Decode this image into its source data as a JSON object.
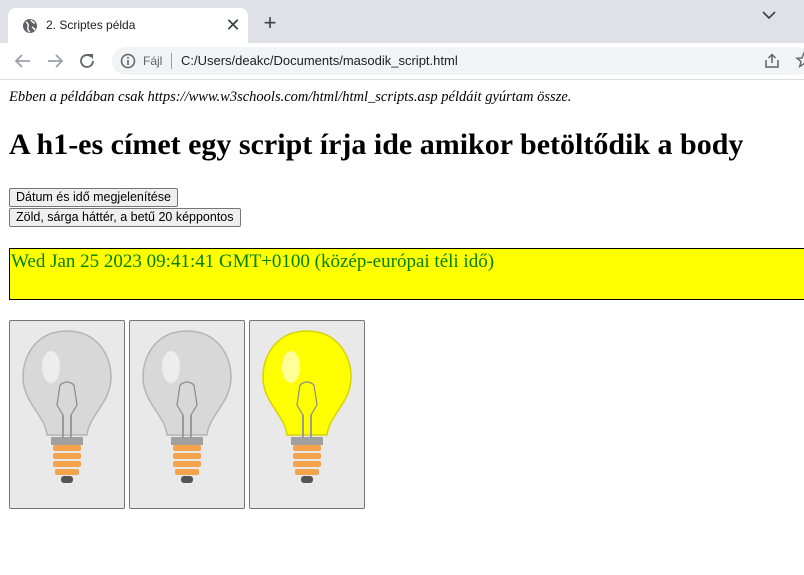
{
  "tab": {
    "title": "2. Scriptes példa",
    "favicon": "globe-icon",
    "close": "✕"
  },
  "newtab": "+",
  "toolbar": {
    "scheme_label": "Fájl",
    "url": "C:/Users/deakc/Documents/masodik_script.html"
  },
  "page": {
    "intro": "Ebben a példában csak https://www.w3schools.com/html/html_scripts.asp példáit gyúrtam össze.",
    "heading": "A h1-es címet egy script írja ide amikor betöltődik a body",
    "button_datetime": "Dátum és idő megjelenítése",
    "button_style": "Zöld, sárga háttér, a betű 20 képpontos",
    "demo_text": "Wed Jan 25 2023 09:41:41 GMT+0100 (közép-európai téli idő)",
    "bulbs": [
      {
        "state": "off",
        "color": "#d8d8d8"
      },
      {
        "state": "off",
        "color": "#d8d8d8"
      },
      {
        "state": "on",
        "color": "#ffff00"
      }
    ]
  },
  "colors": {
    "tabstrip": "#dee1e6",
    "demo_bg": "#ffff00",
    "demo_text": "#008000",
    "bulb_base": "#f4a24c"
  }
}
